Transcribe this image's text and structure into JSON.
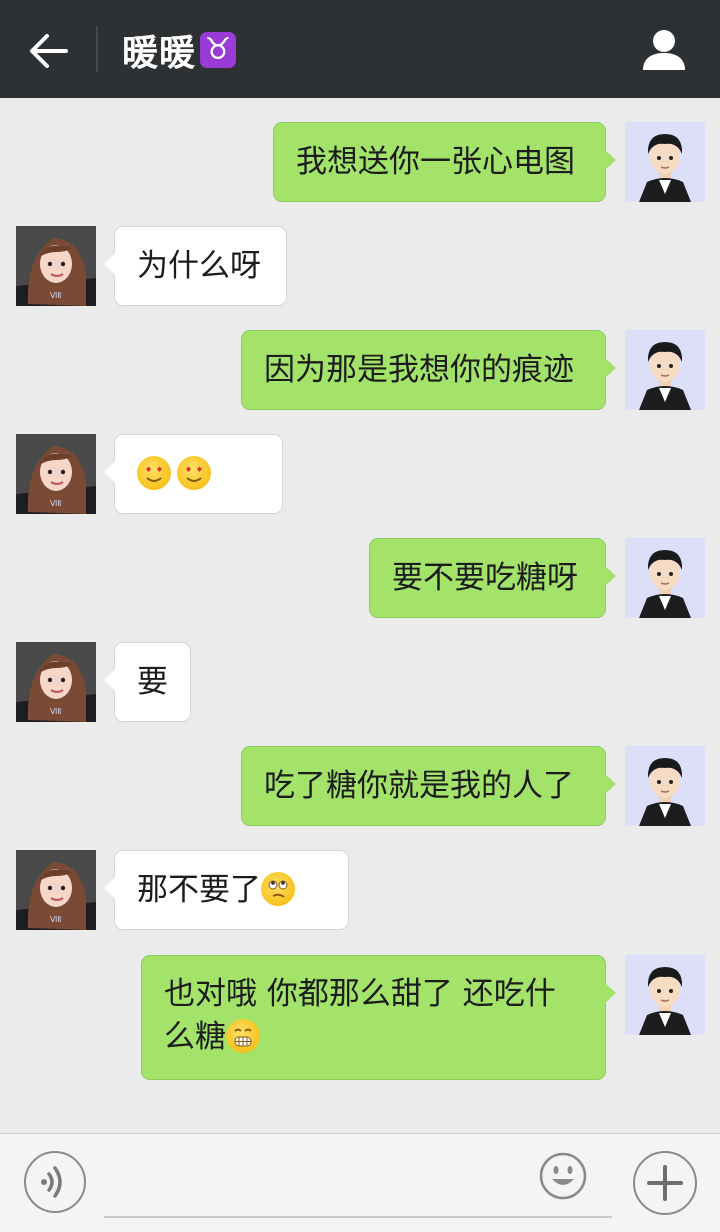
{
  "header": {
    "title": "暖暖",
    "zodiac_symbol": "♉",
    "zodiac_color": "#9b3bd6",
    "back_icon": "arrow-left-icon",
    "profile_icon": "person-icon"
  },
  "messages": [
    {
      "from": "me",
      "text": "我想送你一张心电图"
    },
    {
      "from": "her",
      "text": "为什么呀"
    },
    {
      "from": "me",
      "text": "因为那是我想你的痕迹"
    },
    {
      "from": "her",
      "emojis": [
        "heart-eyes-emoji",
        "heart-eyes-emoji"
      ]
    },
    {
      "from": "me",
      "text": "要不要吃糖呀"
    },
    {
      "from": "her",
      "text": "要"
    },
    {
      "from": "me",
      "text": "吃了糖你就是我的人了"
    },
    {
      "from": "her",
      "text": "那不要了",
      "emojis": [
        "rolling-eyes-emoji"
      ]
    },
    {
      "from": "me",
      "text_line1": "也对哦 你都那么甜了 还吃什",
      "text_line2": "么糖",
      "emojis": [
        "grinning-teeth-emoji"
      ]
    }
  ],
  "colors": {
    "header_bg": "#2d3134",
    "chat_bg": "#ebebeb",
    "outgoing_bubble": "#a3e36a",
    "incoming_bubble": "#ffffff"
  },
  "inputbar": {
    "voice_icon": "voice-icon",
    "emoji_icon": "smiley-icon",
    "plus_icon": "plus-icon"
  }
}
